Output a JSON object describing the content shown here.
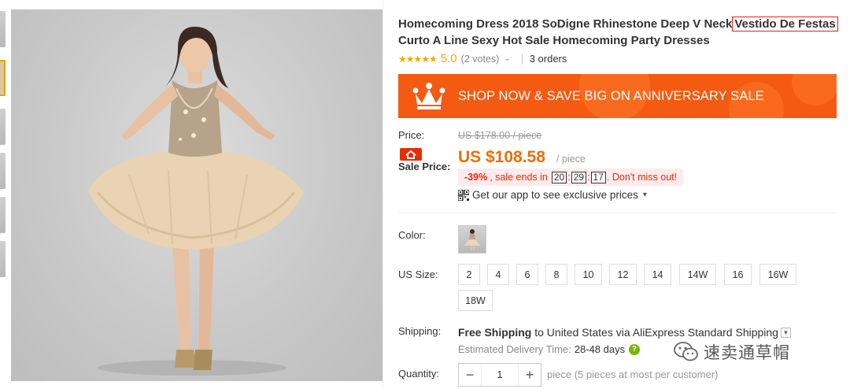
{
  "product": {
    "title_main": "Homecoming Dress 2018 SoDigne Rhinestone Deep V Neck",
    "title_highlight": "Vestido De Festas",
    "title_rest": "Curto A Line Sexy Hot Sale Homecoming Party Dresses"
  },
  "rating": {
    "stars": "★★★★★",
    "score": "5.0",
    "votes": "(2 votes)",
    "orders": "3 orders"
  },
  "banner": {
    "text": "SHOP NOW & SAVE BIG ON ANNIVERSARY SALE"
  },
  "price": {
    "label": "Price:",
    "original": "US $178.00 / piece",
    "sale_label": "Sale Price:",
    "sale": "US $108.58",
    "unit": "/ piece",
    "discount": "-39%",
    "sale_ends": ", sale ends in",
    "timer": {
      "h": "20",
      "m": "29",
      "s": "17"
    },
    "dont_miss": ". Don't miss out!",
    "app_promo": "Get our app to see exclusive prices"
  },
  "options": {
    "color_label": "Color:",
    "size_label": "US Size:",
    "sizes": [
      "2",
      "4",
      "6",
      "8",
      "10",
      "12",
      "14",
      "14W",
      "16",
      "16W",
      "18W"
    ]
  },
  "shipping": {
    "label": "Shipping:",
    "line_bold": "Free Shipping",
    "line_rest": "to United States via AliExpress Standard Shipping",
    "est_label": "Estimated Delivery Time:",
    "est_days": "28-48 days"
  },
  "quantity": {
    "label": "Quantity:",
    "value": "1",
    "hint": "piece (5 pieces at most per customer)"
  },
  "watermark": {
    "text": "速卖通草帽"
  },
  "colors": {
    "accent": "#f45a12",
    "price": "#e8700c",
    "star": "#f6a700",
    "highlight_box": "#e02020"
  }
}
